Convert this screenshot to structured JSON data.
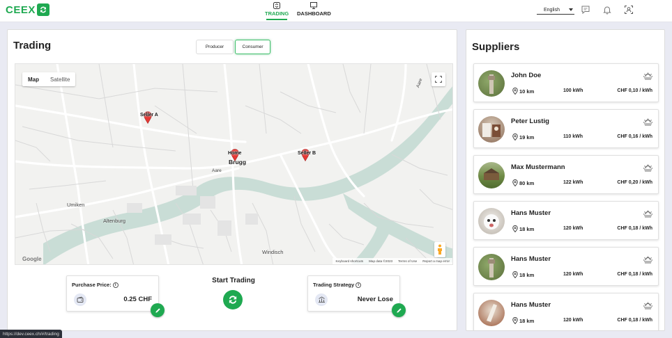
{
  "brand": {
    "name": "CEEX"
  },
  "nav": {
    "tabs": [
      {
        "label": "TRADING",
        "active": true
      },
      {
        "label": "DASHBOARD",
        "active": false
      }
    ],
    "language": "English"
  },
  "trading": {
    "title": "Trading",
    "role_toggle": {
      "producer": "Producer",
      "consumer": "Consumer",
      "selected": "Consumer"
    },
    "map": {
      "type_map": "Map",
      "type_satellite": "Satellite",
      "markers": [
        {
          "label": "Seller A"
        },
        {
          "label": "Home"
        },
        {
          "label": "Seller B"
        }
      ],
      "places": {
        "brugg": "Brugg",
        "aare1": "Aare",
        "aare2": "Aare",
        "umiken": "Umiken",
        "altenburg": "Altenburg",
        "windisch": "Windisch"
      },
      "attribution": {
        "google": "Google",
        "shortcuts": "Keyboard shortcuts",
        "data": "Map data ©2023",
        "terms": "Terms of Use",
        "report": "Report a map error"
      }
    },
    "purchase_price": {
      "label": "Purchase Price:",
      "value": "0.25 CHF"
    },
    "start_trading": {
      "label": "Start Trading"
    },
    "strategy": {
      "label": "Trading Strategy",
      "value": "Never Lose"
    }
  },
  "suppliers": {
    "title": "Suppliers",
    "items": [
      {
        "name": "John Doe",
        "distance": "10 km",
        "energy": "100 kWh",
        "price": "CHF 0,10 / kWh"
      },
      {
        "name": "Peter Lustig",
        "distance": "19 km",
        "energy": "110 kWh",
        "price": "CHF 0,16 / kWh"
      },
      {
        "name": "Max Mustermann",
        "distance": "80 km",
        "energy": "122 kWh",
        "price": "CHF 0,20 / kWh"
      },
      {
        "name": "Hans Muster",
        "distance": "18 km",
        "energy": "120 kWh",
        "price": "CHF 0,18 / kWh"
      },
      {
        "name": "Hans Muster",
        "distance": "18 km",
        "energy": "120 kWh",
        "price": "CHF 0,18 / kWh"
      },
      {
        "name": "Hans Muster",
        "distance": "18 km",
        "energy": "120 kWh",
        "price": "CHF 0,18 / kWh"
      }
    ]
  },
  "status_bar": {
    "url": "https://dev.ceex.ch/#/trading"
  },
  "colors": {
    "accent": "#1fa951",
    "background": "#e9eaf3",
    "river": "#c9ddd6",
    "marker": "#e53935"
  }
}
